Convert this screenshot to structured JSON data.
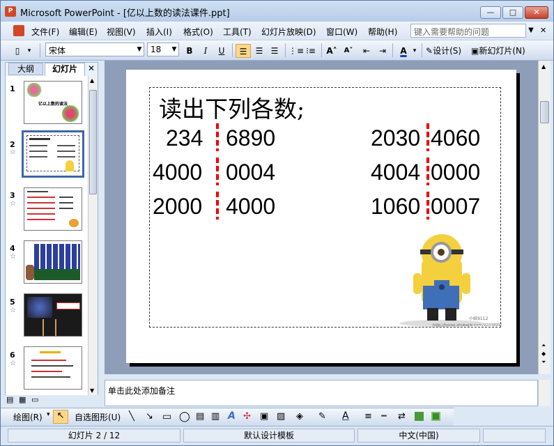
{
  "window": {
    "title": "Microsoft PowerPoint - [亿以上数的读法课件.ppt]",
    "app_icon_text": "P",
    "min_label": "—",
    "max_label": "□",
    "close_label": "✕"
  },
  "menubar": {
    "items": [
      "文件(F)",
      "编辑(E)",
      "视图(V)",
      "插入(I)",
      "格式(O)",
      "工具(T)",
      "幻灯片放映(D)",
      "窗口(W)",
      "帮助(H)"
    ],
    "help_placeholder": "键入需要帮助的问题",
    "close_label": "✕"
  },
  "toolbar": {
    "font": "宋体",
    "size": "18",
    "bold": "B",
    "italic": "I",
    "underline": "U",
    "design_label": "设计(S)",
    "new_slide_label": "新幻灯片(N)"
  },
  "left_panel": {
    "tab_outline": "大纲",
    "tab_slides": "幻灯片",
    "close_label": "✕",
    "thumbs": [
      {
        "num": "1",
        "caption": "亿以上数的读法",
        "selected": false
      },
      {
        "num": "2",
        "caption": "",
        "selected": true
      },
      {
        "num": "3",
        "caption": "",
        "selected": false
      },
      {
        "num": "4",
        "caption": "",
        "selected": false
      },
      {
        "num": "5",
        "caption": "",
        "selected": false
      },
      {
        "num": "6",
        "caption": "",
        "selected": false
      }
    ]
  },
  "slide": {
    "title": "读出下列各数;",
    "rows": [
      {
        "l_left": "234",
        "l_right": "6890",
        "r_left": "2030",
        "r_right": "4060"
      },
      {
        "l_left": "4000",
        "l_right": "0004",
        "r_left": "4004",
        "r_right": "0000"
      },
      {
        "l_left": "2000",
        "l_right": "4000",
        "r_left": "1060",
        "r_right": "0007"
      }
    ],
    "watermark_line1": "小妖9112",
    "watermark_line2": "http://home.zhubajie.com/9203899/"
  },
  "notes": {
    "placeholder": "单击此处添加备注"
  },
  "drawbar": {
    "draw_label": "绘图(R)",
    "autoshape_label": "自选图形(U)"
  },
  "status": {
    "slide_info": "幻灯片 2 / 12",
    "template": "默认设计模板",
    "language": "中文(中国)"
  },
  "colors": {
    "accent": "#3f66a8",
    "separator_red": "#e00000"
  }
}
